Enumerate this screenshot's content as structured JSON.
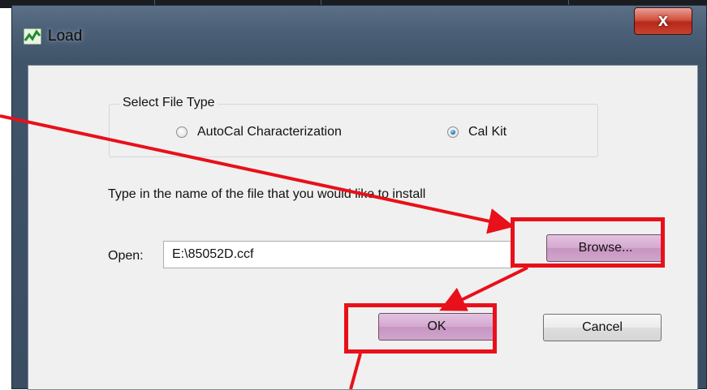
{
  "window": {
    "title": "Load",
    "close_glyph": "x",
    "icon": "app-logo-icon"
  },
  "file_type": {
    "legend": "Select File Type",
    "options": [
      {
        "label": "AutoCal Characterization",
        "checked": false
      },
      {
        "label": "Cal Kit",
        "checked": true
      }
    ]
  },
  "instruction": "Type in the name of the file that you would like to install",
  "open": {
    "label": "Open:",
    "value": "E:\\85052D.ccf"
  },
  "buttons": {
    "browse": "Browse...",
    "ok": "OK",
    "cancel": "Cancel"
  },
  "annotations": {
    "highlight_color": "#e8101a",
    "button_highlight_color": "#d4a8d0"
  }
}
